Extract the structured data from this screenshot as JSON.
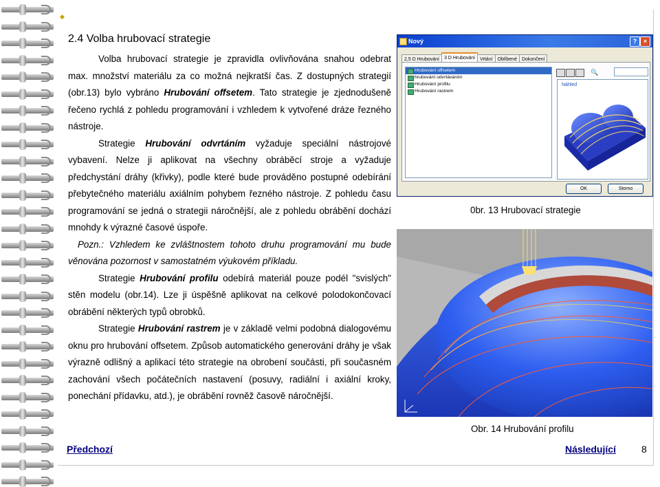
{
  "section_heading": "2.4 Volba hrubovací strategie",
  "paragraphs": {
    "p1": "Volba hrubovací strategie je zpravidla ovlivňována snahou odebrat max. množství materiálu za co možná nejkratší čas. Z dostupných strategií (obr.13) bylo vybráno ",
    "p1_bold": "Hrubování offsetem",
    "p1_end": ". Tato strategie je zjednodušeně řečeno rychlá z pohledu programování i vzhledem k vytvořené dráze řezného nástroje.",
    "p2_start": "Strategie ",
    "p2_bold": "Hrubování odvrtáním",
    "p2_end": " vyžaduje speciální nástrojové vybavení. Nelze ji aplikovat na všechny obráběcí stroje a vyžaduje předchystání dráhy (křivky), podle které bude prováděno postupné odebírání přebytečného materiálu axiálním pohybem řezného nástroje. Z pohledu času programování se jedná o strategii náročnější, ale z pohledu obrábění dochází mnohdy k výrazné časové úspoře.",
    "note": "Pozn.: Vzhledem ke zvláštnostem tohoto druhu programování mu bude věnována pozornost v samostatném výukovém příkladu.",
    "p3_start": "Strategie ",
    "p3_bold": "Hrubování profilu",
    "p3_end": " odebírá materiál pouze podél \"svislých\" stěn modelu (obr.14). Lze ji úspěšně aplikovat na celkové polodokončovací obrábění některých typů obrobků.",
    "p4_start": "Strategie ",
    "p4_bold": "Hrubování rastrem",
    "p4_end": " je v základě velmi podobná dialogovému oknu pro hrubování offsetem. Způsob automatického generování dráhy je však výrazně odlišný a aplikací této strategie na obrobení součásti, při současném zachování všech počátečních nastavení (posuvy, radiální i axiální kroky, ponechání přídavku, atd.), je obrábění rovněž časově náročnější."
  },
  "figure13": {
    "caption": "0br. 13 Hrubovací strategie",
    "dialog": {
      "title": "Nový",
      "tabs": [
        "2,5 D Hrubování",
        "3 D Hrubování",
        "Vrtání",
        "Oblíbené",
        "Dokončení"
      ],
      "active_tab": 1,
      "items": [
        "Hrubování offsetem",
        "hrubování odvrtáváním",
        "Hrubování profilu",
        "Hrubování rastrem"
      ],
      "selected_item": 0,
      "preview_label": "Náhled",
      "ok": "OK",
      "cancel": "Storno"
    }
  },
  "figure14": {
    "caption": "Obr. 14 Hrubování profilu"
  },
  "footer": {
    "prev": "Předchozí",
    "next": "Následující",
    "page": "8"
  }
}
